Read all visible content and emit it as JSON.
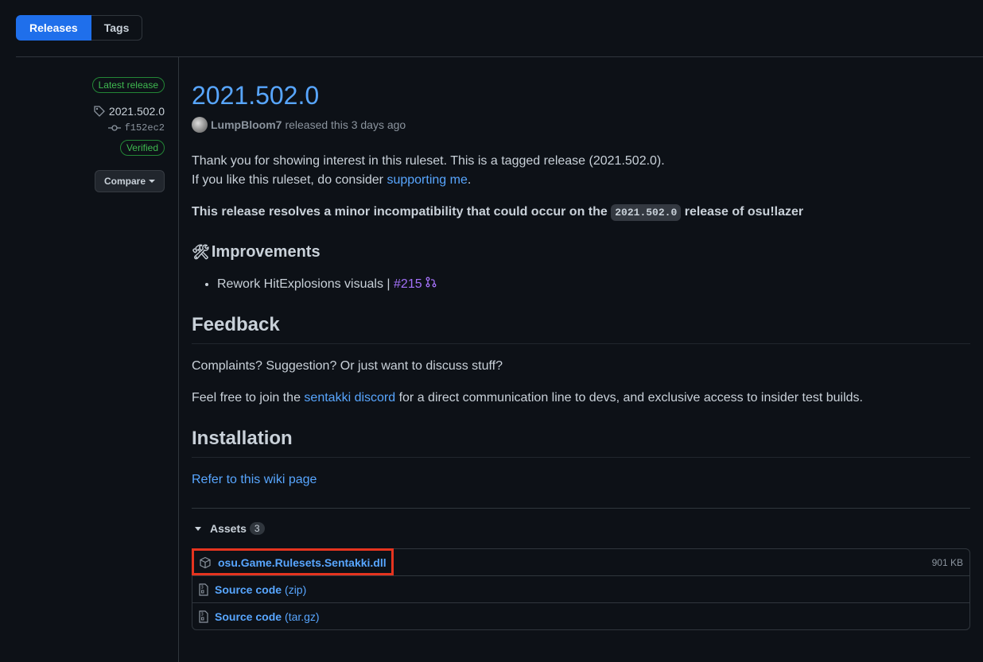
{
  "tabs": {
    "releases": "Releases",
    "tags": "Tags"
  },
  "sidebar": {
    "latest_badge": "Latest release",
    "tag": "2021.502.0",
    "commit": "f152ec2",
    "verified": "Verified",
    "compare": "Compare"
  },
  "release": {
    "title": "2021.502.0",
    "author": "LumpBloom7",
    "released_text": "released this 3 days ago",
    "intro_1": "Thank you for showing interest in this ruleset. This is a tagged release (2021.502.0).",
    "intro_2a": "If you like this ruleset, do consider ",
    "intro_2_link": "supporting me",
    "intro_2b": ".",
    "bold_a": "This release resolves a minor incompatibility that could occur on the ",
    "bold_code": "2021.502.0",
    "bold_b": " release of osu!lazer",
    "improvements_emoji": "🛠",
    "improvements_heading": "Improvements",
    "improvement_item": "Rework HitExplosions visuals | ",
    "improvement_pr": "#215",
    "feedback_heading": "Feedback",
    "feedback_1": "Complaints? Suggestion? Or just want to discuss stuff?",
    "feedback_2a": "Feel free to join the ",
    "feedback_2_link": "sentakki discord",
    "feedback_2b": " for a direct communication line to devs, and exclusive access to insider test builds.",
    "installation_heading": "Installation",
    "install_link": "Refer to this wiki page"
  },
  "assets": {
    "label": "Assets",
    "count": "3",
    "items": [
      {
        "name": "osu.Game.Rulesets.Sentakki.dll",
        "ext": "",
        "size": "901 KB",
        "icon": "package-icon"
      },
      {
        "name": "Source code",
        "ext": "(zip)",
        "size": "",
        "icon": "file-zip-icon"
      },
      {
        "name": "Source code",
        "ext": "(tar.gz)",
        "size": "",
        "icon": "file-zip-icon"
      }
    ]
  },
  "colors": {
    "accent": "#58a6ff",
    "background": "#0d1117",
    "highlight": "#e5341f",
    "verified": "#3fb950"
  }
}
